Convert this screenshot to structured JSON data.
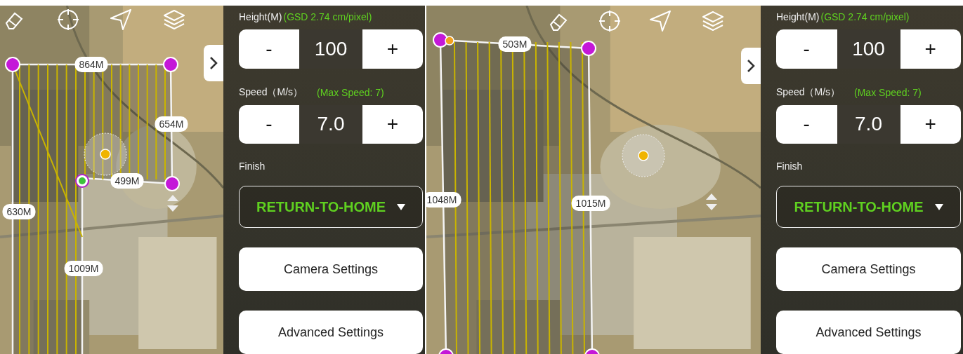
{
  "screens": [
    {
      "map": {
        "distance_labels": [
          "864M",
          "654M",
          "499M",
          "630M",
          "1009M"
        ]
      },
      "panel": {
        "height": {
          "label": "Height(M)",
          "note": "(GSD 2.74 cm/pixel)",
          "minus": "-",
          "value": "100",
          "plus": "+"
        },
        "speed": {
          "label": "Speed（M/s）",
          "note": "(Max Speed: 7)",
          "minus": "-",
          "value": "7.0",
          "plus": "+"
        },
        "finish": {
          "label": "Finish",
          "value": "RETURN-TO-HOME"
        },
        "buttons": [
          "Camera Settings",
          "Advanced Settings"
        ]
      }
    },
    {
      "map": {
        "distance_labels": [
          "503M",
          "1048M",
          "1015M"
        ]
      },
      "panel": {
        "height": {
          "label": "Height(M)",
          "note": "(GSD 2.74 cm/pixel)",
          "minus": "-",
          "value": "100",
          "plus": "+"
        },
        "speed": {
          "label": "Speed（M/s）",
          "note": "(Max Speed: 7)",
          "minus": "-",
          "value": "7.0",
          "plus": "+"
        },
        "finish": {
          "label": "Finish",
          "value": "RETURN-TO-HOME"
        },
        "buttons": [
          "Camera Settings",
          "Advanced Settings"
        ]
      }
    }
  ]
}
